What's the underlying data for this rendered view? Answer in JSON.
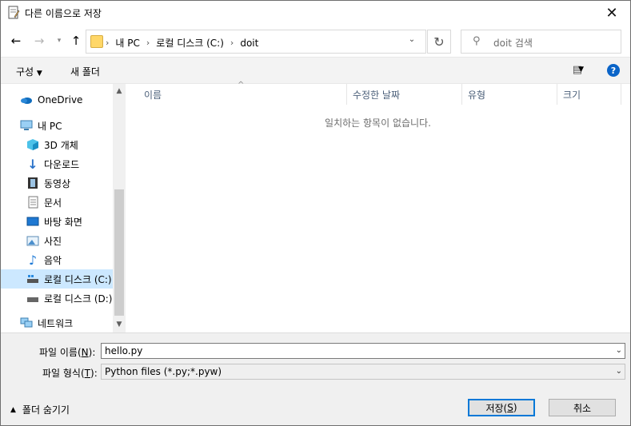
{
  "window": {
    "title": "다른 이름으로 저장",
    "close_label": "✕"
  },
  "nav": {
    "breadcrumbs": [
      "내 PC",
      "로컬 디스크 (C:)",
      "doit"
    ],
    "search_placeholder": "doit 검색"
  },
  "toolbar": {
    "organize": "구성",
    "new_folder": "새 폴더",
    "help": "?"
  },
  "sidebar": {
    "items": [
      {
        "label": "OneDrive",
        "icon": "cloud-icon"
      },
      {
        "label": "내 PC",
        "icon": "computer-icon"
      },
      {
        "label": "3D 개체",
        "icon": "cube-icon"
      },
      {
        "label": "다운로드",
        "icon": "download-arrow-icon"
      },
      {
        "label": "동영상",
        "icon": "film-icon"
      },
      {
        "label": "문서",
        "icon": "document-icon"
      },
      {
        "label": "바탕 화면",
        "icon": "desktop-icon"
      },
      {
        "label": "사진",
        "icon": "picture-icon"
      },
      {
        "label": "음악",
        "icon": "music-note-icon"
      },
      {
        "label": "로컬 디스크 (C:)",
        "icon": "drive-icon",
        "selected": true
      },
      {
        "label": "로컬 디스크 (D:)",
        "icon": "drive-icon"
      },
      {
        "label": "네트워크",
        "icon": "network-icon"
      }
    ]
  },
  "columns": [
    "이름",
    "수정한 날짜",
    "유형",
    "크기"
  ],
  "empty_message": "일치하는 항목이 없습니다.",
  "form": {
    "filename_label": "파일 이름(",
    "filename_key": "N",
    "filename_label_end": "):",
    "filename_value": "hello.py",
    "filetype_label": "파일 형식(",
    "filetype_key": "T",
    "filetype_label_end": "):",
    "filetype_value": "Python files (*.py;*.pyw)"
  },
  "footer": {
    "hide_folders": "폴더 숨기기",
    "save": "저장(",
    "save_key": "S",
    "save_end": ")",
    "cancel": "취소"
  }
}
